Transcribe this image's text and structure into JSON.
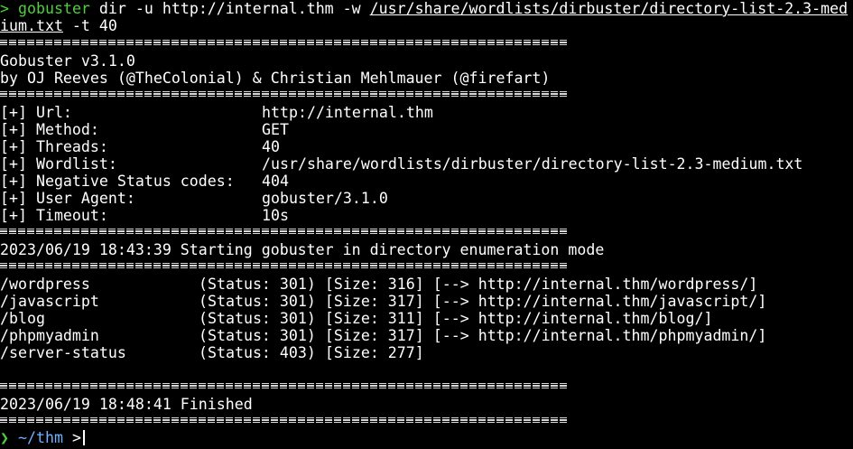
{
  "command": {
    "prompt_symbol": ">",
    "program": "gobuster",
    "args_before": " dir -u http://internal.thm -w ",
    "wordlist_line1": "/usr/share/wordlists/dirbuster/directory-list-2.3-med",
    "wordlist_line2": "ium.txt",
    "args_after": " -t 40"
  },
  "banner": {
    "version": "Gobuster v3.1.0",
    "authors": "by OJ Reeves (@TheColonial) & Christian Mehlmauer (@firefart)"
  },
  "config": [
    {
      "key": "[+] Url:",
      "value": "http://internal.thm"
    },
    {
      "key": "[+] Method:",
      "value": "GET"
    },
    {
      "key": "[+] Threads:",
      "value": "40"
    },
    {
      "key": "[+] Wordlist:",
      "value": "/usr/share/wordlists/dirbuster/directory-list-2.3-medium.txt"
    },
    {
      "key": "[+] Negative Status codes:",
      "value": "404"
    },
    {
      "key": "[+] User Agent:",
      "value": "gobuster/3.1.0"
    },
    {
      "key": "[+] Timeout:",
      "value": "10s"
    }
  ],
  "start_message": "2023/06/19 18:43:39 Starting gobuster in directory enumeration mode",
  "results": [
    {
      "path": "/wordpress",
      "info": "(Status: 301) [Size: 316] [--> http://internal.thm/wordpress/]"
    },
    {
      "path": "/javascript",
      "info": "(Status: 301) [Size: 317] [--> http://internal.thm/javascript/]"
    },
    {
      "path": "/blog",
      "info": "(Status: 301) [Size: 311] [--> http://internal.thm/blog/]"
    },
    {
      "path": "/phpmyadmin",
      "info": "(Status: 301) [Size: 317] [--> http://internal.thm/phpmyadmin/]"
    },
    {
      "path": "/server-status",
      "info": "(Status: 403) [Size: 277]"
    }
  ],
  "finish_message": "2023/06/19 18:48:41 Finished",
  "prompt": {
    "arrow": "❯",
    "cwd": "~/thm",
    "symbol": ">"
  },
  "colors": {
    "background": "#000000",
    "text": "#ffffff",
    "accent_green": "#4cd13a",
    "path_blue": "#6fb0ff"
  }
}
